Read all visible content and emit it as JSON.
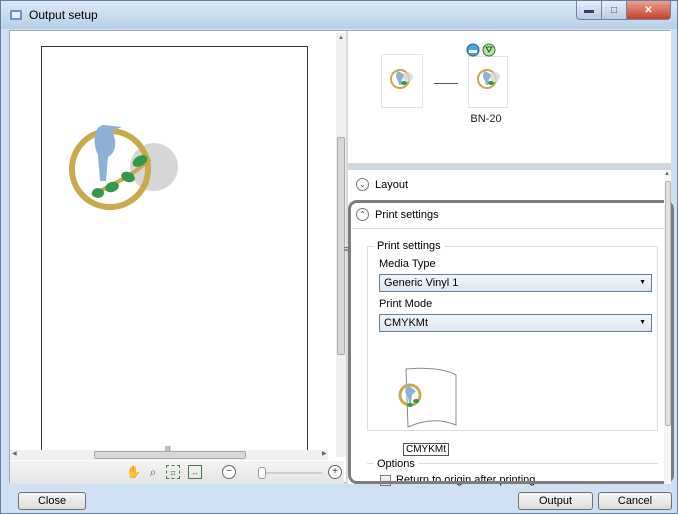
{
  "window": {
    "title": "Output setup",
    "buttons": {
      "minimize": "▬",
      "maximize": "□",
      "close": "✕"
    }
  },
  "sketch": {
    "device_label": "BN-20",
    "icons": [
      "print-head-icon",
      "filter-icon"
    ]
  },
  "panel": {
    "layout_header": "Layout",
    "print_settings_header": "Print settings",
    "group_title": "Print settings",
    "media_type": {
      "label": "Media Type",
      "value": "Generic Vinyl 1"
    },
    "print_mode": {
      "label": "Print Mode",
      "value": "CMYKMt"
    },
    "media_tag": "CMYKMt",
    "options": {
      "title": "Options",
      "return_to_origin": {
        "label": "Return to origin after printing",
        "checked": false
      }
    }
  },
  "toolbar": {
    "icons": [
      "hand-icon",
      "magnify-icon",
      "fit-icon",
      "actual-size-icon",
      "zoom-out-icon",
      "zoom-in-icon"
    ],
    "hscroll_grip": "III",
    "splitter_grip": "≡"
  },
  "footer": {
    "close_label": "Close",
    "output_label": "Output",
    "cancel_label": "Cancel"
  },
  "colors": {
    "bird": "#8fb0d6",
    "ring": "#c8a94c",
    "leaf": "#2f9a4a",
    "gray_circle": "#d6d6d6"
  }
}
